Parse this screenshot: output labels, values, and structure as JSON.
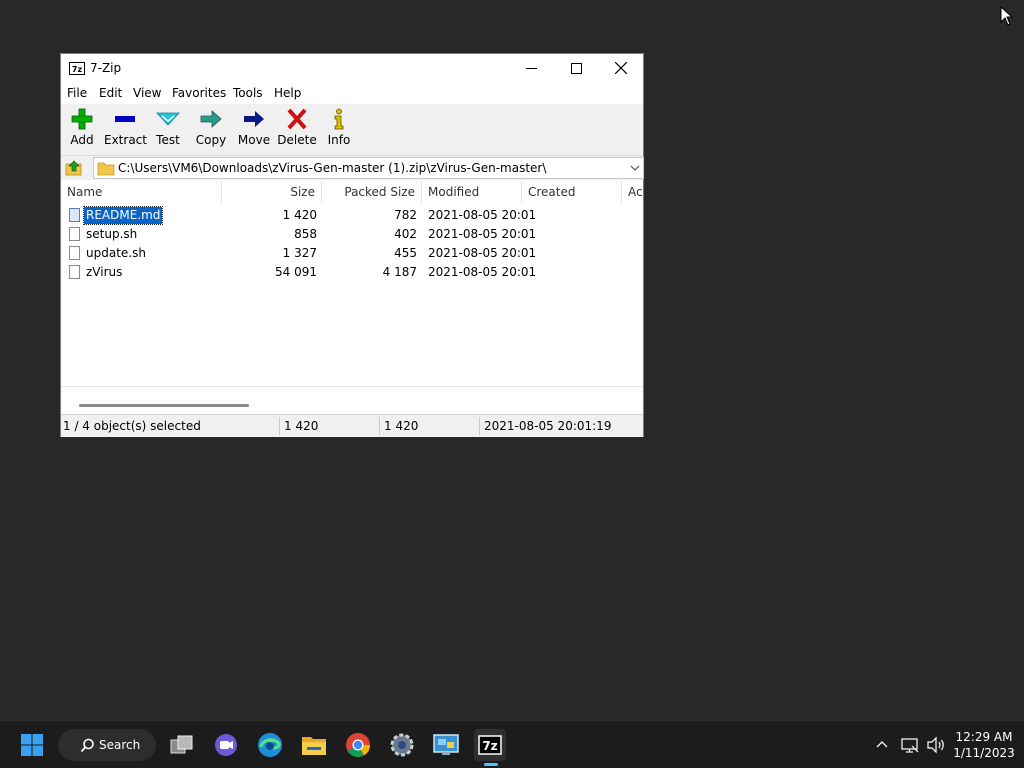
{
  "window": {
    "title": "7-Zip",
    "app_icon_text": "7z"
  },
  "menu": [
    "File",
    "Edit",
    "View",
    "Favorites",
    "Tools",
    "Help"
  ],
  "toolbar": [
    {
      "label": "Add",
      "icon": "add-icon",
      "color": "#00b000"
    },
    {
      "label": "Extract",
      "icon": "extract-icon",
      "color": "#0000c0"
    },
    {
      "label": "Test",
      "icon": "test-icon",
      "color": "#20b8c8"
    },
    {
      "label": "Copy",
      "icon": "copy-icon",
      "color": "#2a9a8a"
    },
    {
      "label": "Move",
      "icon": "move-icon",
      "color": "#0a1a8a"
    },
    {
      "label": "Delete",
      "icon": "delete-icon",
      "color": "#d01010"
    },
    {
      "label": "Info",
      "icon": "info-icon",
      "color": "#c8a800"
    }
  ],
  "address": {
    "path": "C:\\Users\\VM6\\Downloads\\zVirus-Gen-master (1).zip\\zVirus-Gen-master\\"
  },
  "columns": [
    "Name",
    "Size",
    "Packed Size",
    "Modified",
    "Created",
    "Ac"
  ],
  "files": [
    {
      "name": "README.md",
      "size": "1 420",
      "packed": "782",
      "modified": "2021-08-05 20:01",
      "created": "",
      "selected": true
    },
    {
      "name": "setup.sh",
      "size": "858",
      "packed": "402",
      "modified": "2021-08-05 20:01",
      "created": "",
      "selected": false
    },
    {
      "name": "update.sh",
      "size": "1 327",
      "packed": "455",
      "modified": "2021-08-05 20:01",
      "created": "",
      "selected": false
    },
    {
      "name": "zVirus",
      "size": "54 091",
      "packed": "4 187",
      "modified": "2021-08-05 20:01",
      "created": "",
      "selected": false
    }
  ],
  "status": {
    "selection": "1 / 4 object(s) selected",
    "size": "1 420",
    "packed": "1 420",
    "modified": "2021-08-05 20:01:19"
  },
  "taskbar": {
    "search_label": "Search",
    "apps": [
      "start-icon",
      "task-view-icon",
      "teams-chat-icon",
      "edge-icon",
      "file-explorer-icon",
      "chrome-icon",
      "settings-icon",
      "control-panel-icon",
      "7zip-icon"
    ],
    "active_app": "7zip-icon",
    "time": "12:29 AM",
    "date": "1/11/2023"
  }
}
